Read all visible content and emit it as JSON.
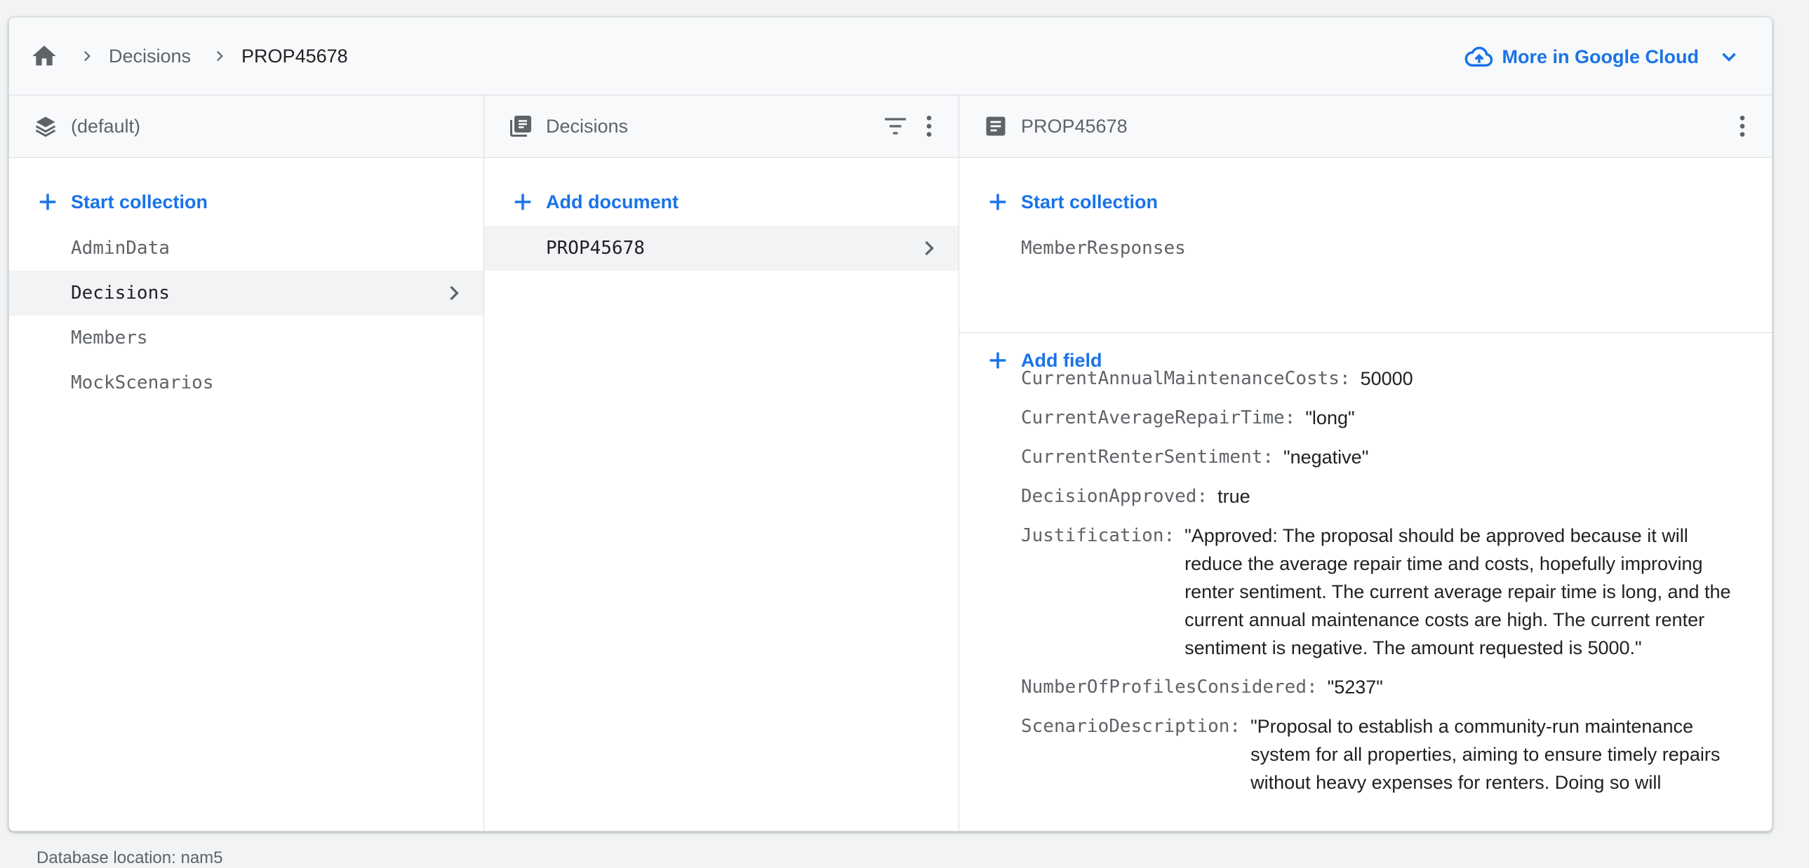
{
  "breadcrumb": {
    "items": [
      "Decisions",
      "PROP45678"
    ]
  },
  "header": {
    "more_cloud": "More in Google Cloud"
  },
  "panel_db": {
    "title": "(default)",
    "add_label": "Start collection",
    "collections": [
      "AdminData",
      "Decisions",
      "Members",
      "MockScenarios"
    ],
    "selected": "Decisions"
  },
  "panel_collection": {
    "title": "Decisions",
    "add_label": "Add document",
    "documents": [
      "PROP45678"
    ]
  },
  "panel_document": {
    "title": "PROP45678",
    "add_collection_label": "Start collection",
    "subcollections": [
      "MemberResponses"
    ],
    "add_field_label": "Add field",
    "fields": [
      {
        "key": "CurrentAnnualMaintenanceCosts:",
        "value": "50000"
      },
      {
        "key": "CurrentAverageRepairTime:",
        "value": "\"long\""
      },
      {
        "key": "CurrentRenterSentiment:",
        "value": "\"negative\""
      },
      {
        "key": "DecisionApproved:",
        "value": "true"
      },
      {
        "key": "Justification:",
        "value": "\"Approved: The proposal should be approved because it will reduce the average repair time and costs, hopefully improving renter sentiment. The current average repair time is long, and the current annual maintenance costs are high. The current renter sentiment is negative. The amount requested is 5000.\""
      },
      {
        "key": "NumberOfProfilesConsidered:",
        "value": "\"5237\""
      },
      {
        "key": "ScenarioDescription:",
        "value": "\"Proposal to establish a community-run maintenance system for all properties, aiming to ensure timely repairs without heavy expenses for renters. Doing so will"
      }
    ]
  },
  "footer": {
    "text": "Database location: nam5"
  },
  "colors": {
    "accent": "#1a73e8",
    "text": "#202124",
    "muted": "#5f6368"
  }
}
